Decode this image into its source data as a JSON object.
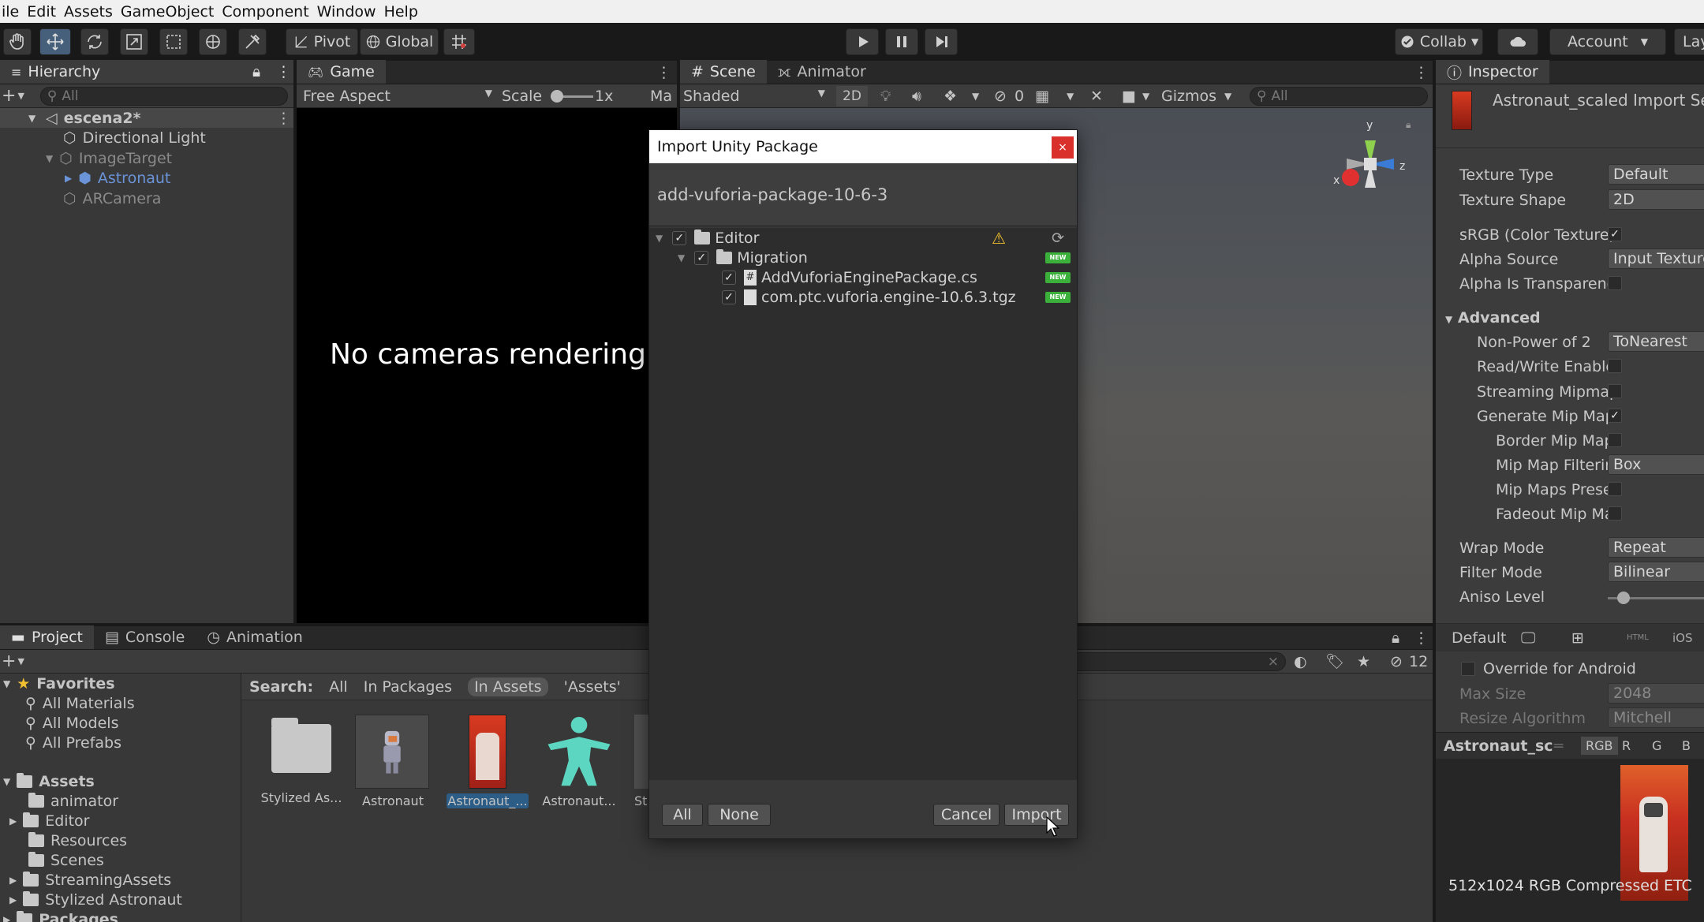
{
  "menu": [
    "ile",
    "Edit",
    "Assets",
    "GameObject",
    "Component",
    "Window",
    "Help"
  ],
  "toolbar": {
    "pivot": "Pivot",
    "global": "Global",
    "collab": "Collab",
    "account": "Account",
    "layers": "Layer"
  },
  "hierarchy": {
    "tab": "Hierarchy",
    "search_placeholder": "All",
    "items": [
      "escena2*",
      "Directional Light",
      "ImageTarget",
      "Astronaut",
      "ARCamera"
    ]
  },
  "game": {
    "tab": "Game",
    "aspect": "Free Aspect",
    "scale_label": "Scale",
    "scale_value": "1x",
    "max_label": "Ma",
    "no_camera": "No cameras rendering"
  },
  "scene": {
    "tab_scene": "Scene",
    "tab_animator": "Animator",
    "shading": "Shaded",
    "mode_2d": "2D",
    "hidden_count": "0",
    "gizmos": "Gizmos",
    "search_placeholder": "All",
    "axis_y": "y",
    "axis_x": "x",
    "axis_z": "z"
  },
  "dialog": {
    "title": "Import Unity Package",
    "close": "×",
    "package_name": "add-vuforia-package-10-6-3",
    "tree": [
      {
        "label": "Editor",
        "depth": 0,
        "type": "folder"
      },
      {
        "label": "Migration",
        "depth": 1,
        "type": "folder",
        "badge": "NEW"
      },
      {
        "label": "AddVuforiaEnginePackage.cs",
        "depth": 2,
        "type": "script",
        "badge": "NEW"
      },
      {
        "label": "com.ptc.vuforia.engine-10.6.3.tgz",
        "depth": 2,
        "type": "file",
        "badge": "NEW"
      }
    ],
    "btn_all": "All",
    "btn_none": "None",
    "btn_cancel": "Cancel",
    "btn_import": "Import"
  },
  "project": {
    "tabs": [
      "Project",
      "Console",
      "Animation"
    ],
    "favorites": "Favorites",
    "fav_items": [
      "All Materials",
      "All Models",
      "All Prefabs"
    ],
    "assets": "Assets",
    "asset_folders": [
      "animator",
      "Editor",
      "Resources",
      "Scenes",
      "StreamingAssets",
      "Stylized Astronaut"
    ],
    "packages": "Packages",
    "search_label": "Search:",
    "search_scopes": [
      "All",
      "In Packages",
      "In Assets",
      "'Assets'"
    ],
    "grid_items": [
      "Stylized As...",
      "Astronaut",
      "Astronaut_...",
      "Astronaut...",
      "St"
    ],
    "hidden_count": "12"
  },
  "inspector": {
    "tab": "Inspector",
    "header": "Astronaut_scaled Import Se",
    "fields": [
      {
        "label": "Texture Type",
        "value": "Default"
      },
      {
        "label": "Texture Shape",
        "value": "2D"
      }
    ],
    "srgb": "sRGB (Color Texture)",
    "alpha_source": "Alpha Source",
    "alpha_source_value": "Input Texture",
    "alpha_transparency": "Alpha Is Transparenc",
    "advanced": "Advanced",
    "npot": "Non-Power of 2",
    "npot_value": "ToNearest",
    "rw": "Read/Write Enable",
    "streaming": "Streaming Mipmap",
    "gen_mips": "Generate Mip Map",
    "border_mips": "Border Mip Map",
    "mip_filter": "Mip Map Filterir",
    "mip_filter_value": "Box",
    "mip_preserve": "Mip Maps Prese",
    "fadeout": "Fadeout Mip Ma",
    "wrap": "Wrap Mode",
    "wrap_value": "Repeat",
    "filter": "Filter Mode",
    "filter_value": "Bilinear",
    "aniso": "Aniso Level",
    "platform_default": "Default",
    "platform_ios": "iOS",
    "override": "Override for Android",
    "max_size": "Max Size",
    "max_size_value": "2048",
    "resize": "Resize Algorithm",
    "resize_value": "Mitchell",
    "preview_name": "Astronaut_sc",
    "ch_rgb": "RGB",
    "ch_r": "R",
    "ch_g": "G",
    "ch_b": "B",
    "preview_info": "512x1024  RGB Compressed ETC"
  }
}
